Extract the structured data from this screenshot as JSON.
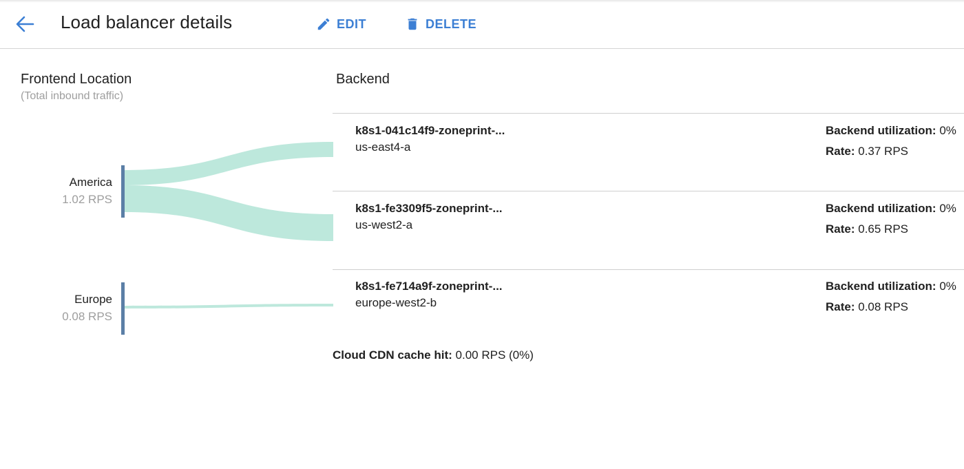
{
  "header": {
    "title": "Load balancer details",
    "edit_label": "EDIT",
    "delete_label": "DELETE"
  },
  "frontend": {
    "heading": "Frontend Location",
    "subheading": "(Total inbound traffic)",
    "regions": [
      {
        "name": "America",
        "rate": "1.02 RPS"
      },
      {
        "name": "Europe",
        "rate": "0.08 RPS"
      }
    ]
  },
  "backend": {
    "heading": "Backend",
    "util_label": "Backend utilization:",
    "rate_label": "Rate:",
    "rows": [
      {
        "name": "k8s1-041c14f9-zoneprint-...",
        "zone": "us-east4-a",
        "utilization": "0%",
        "rate": "0.37 RPS"
      },
      {
        "name": "k8s1-fe3309f5-zoneprint-...",
        "zone": "us-west2-a",
        "utilization": "0%",
        "rate": "0.65 RPS"
      },
      {
        "name": "k8s1-fe714a9f-zoneprint-...",
        "zone": "europe-west2-b",
        "utilization": "0%",
        "rate": "0.08 RPS"
      }
    ]
  },
  "cdn": {
    "label": "Cloud CDN cache hit:",
    "value": "0.00 RPS (0%)"
  },
  "colors": {
    "accent": "#3c7fd4",
    "flow": "#bde8dc",
    "region_bar": "#5b7fa6",
    "muted_text": "#9e9e9e"
  }
}
